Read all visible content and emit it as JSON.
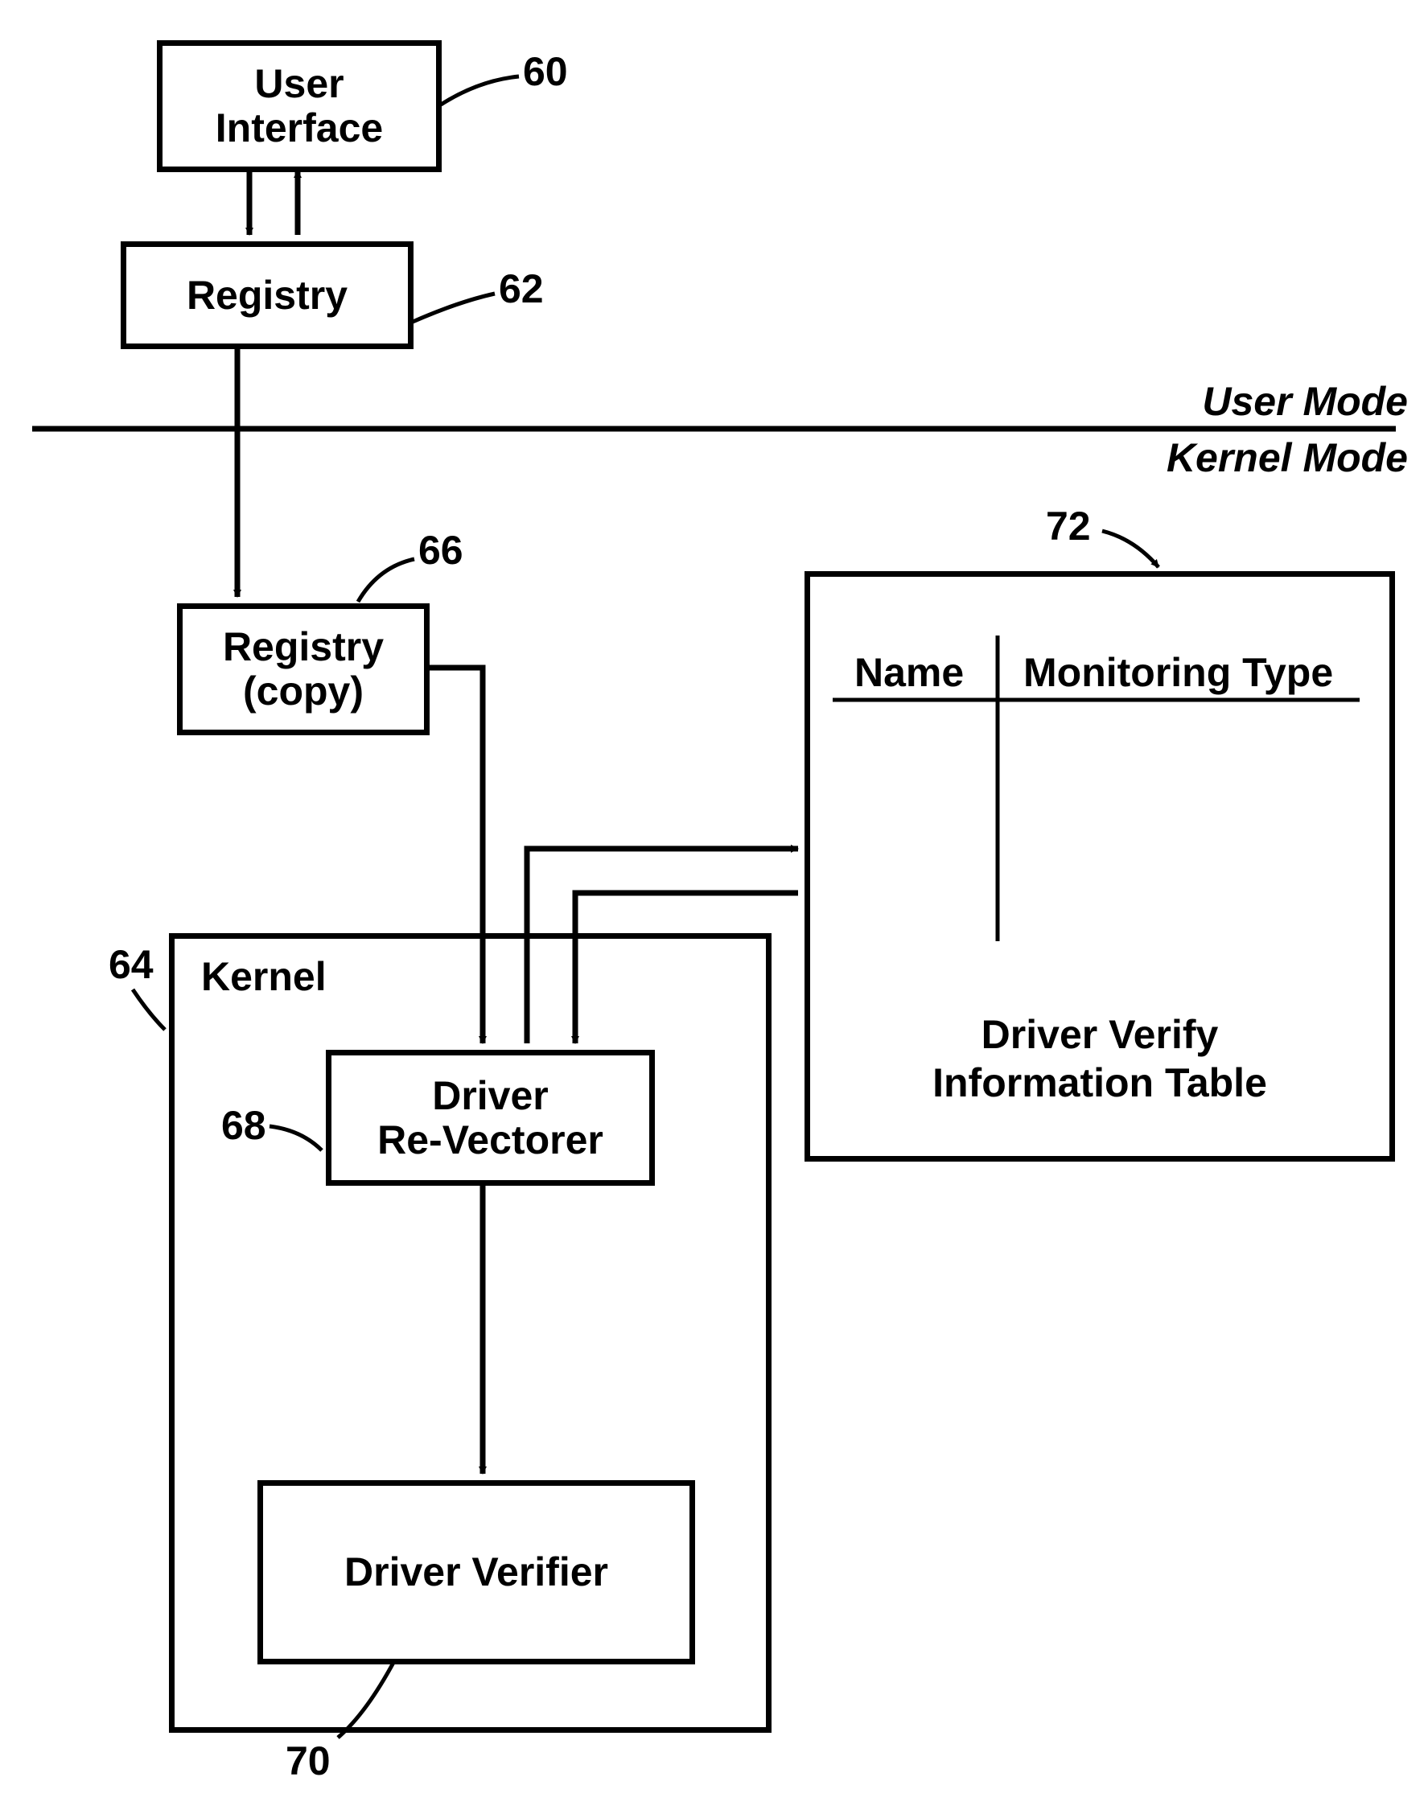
{
  "boxes": {
    "user_interface": "User\nInterface",
    "registry": "Registry",
    "registry_copy": "Registry\n(copy)",
    "kernel": "Kernel",
    "driver_revectorer": "Driver\nRe-Vectorer",
    "driver_verifier": "Driver Verifier"
  },
  "table": {
    "col1": "Name",
    "col2": "Monitoring Type",
    "caption_line1": "Driver Verify",
    "caption_line2": "Information Table"
  },
  "modes": {
    "user": "User Mode",
    "kernel": "Kernel Mode"
  },
  "refs": {
    "r60": "60",
    "r62": "62",
    "r64": "64",
    "r66": "66",
    "r68": "68",
    "r70": "70",
    "r72": "72"
  }
}
